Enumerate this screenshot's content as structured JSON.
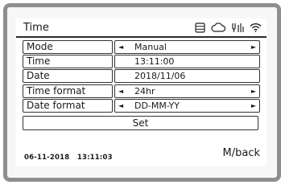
{
  "header": {
    "title": "Time",
    "icons": [
      "storage-icon",
      "cloud-icon",
      "antenna-icon",
      "wifi-icon"
    ]
  },
  "rows": [
    {
      "label": "Mode",
      "value": "Manual",
      "has_arrows": true
    },
    {
      "label": "Time",
      "value": "13:11:00",
      "has_arrows": false
    },
    {
      "label": "Date",
      "value": "2018/11/06",
      "has_arrows": false
    },
    {
      "label": "Time format",
      "value": "24hr",
      "has_arrows": true
    },
    {
      "label": "Date format",
      "value": "DD-MM-YY",
      "has_arrows": true
    }
  ],
  "set_label": "Set",
  "footer": {
    "date": "06-11-2018",
    "time": "13:11:03",
    "back_label": "M/back"
  },
  "arrows": {
    "left": "◄",
    "right": "►"
  }
}
